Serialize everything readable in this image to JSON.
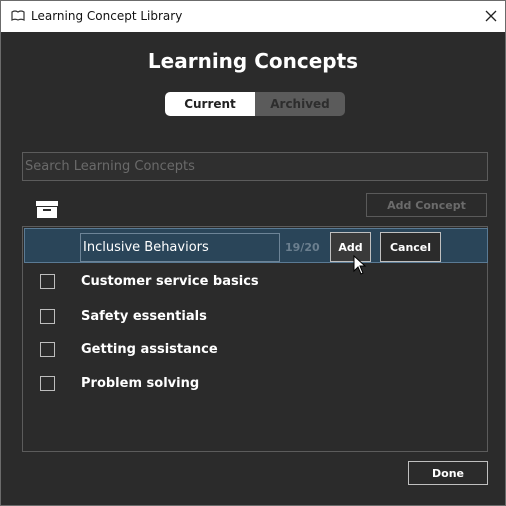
{
  "window": {
    "title": "Learning Concept Library",
    "icons": {
      "app": "book-icon",
      "close": "close-icon"
    }
  },
  "header": {
    "title": "Learning Concepts"
  },
  "tabs": [
    {
      "label": "Current",
      "active": true
    },
    {
      "label": "Archived",
      "active": false
    }
  ],
  "search": {
    "placeholder": "Search Learning Concepts",
    "value": ""
  },
  "toolbar": {
    "archive_icon": "archive-box-icon",
    "add_concept_label": "Add Concept"
  },
  "editor": {
    "value": "Inclusive Behaviors",
    "counter": "19/20",
    "add_label": "Add",
    "cancel_label": "Cancel"
  },
  "concepts": [
    {
      "label": "Customer service basics",
      "checked": false
    },
    {
      "label": "Safety essentials",
      "checked": false
    },
    {
      "label": "Getting assistance",
      "checked": false
    },
    {
      "label": "Problem solving",
      "checked": false
    }
  ],
  "footer": {
    "done_label": "Done"
  },
  "colors": {
    "background": "#2b2b2b",
    "selected_row": "#2a4559",
    "text": "#ffffff",
    "muted": "#6b6b6b"
  }
}
